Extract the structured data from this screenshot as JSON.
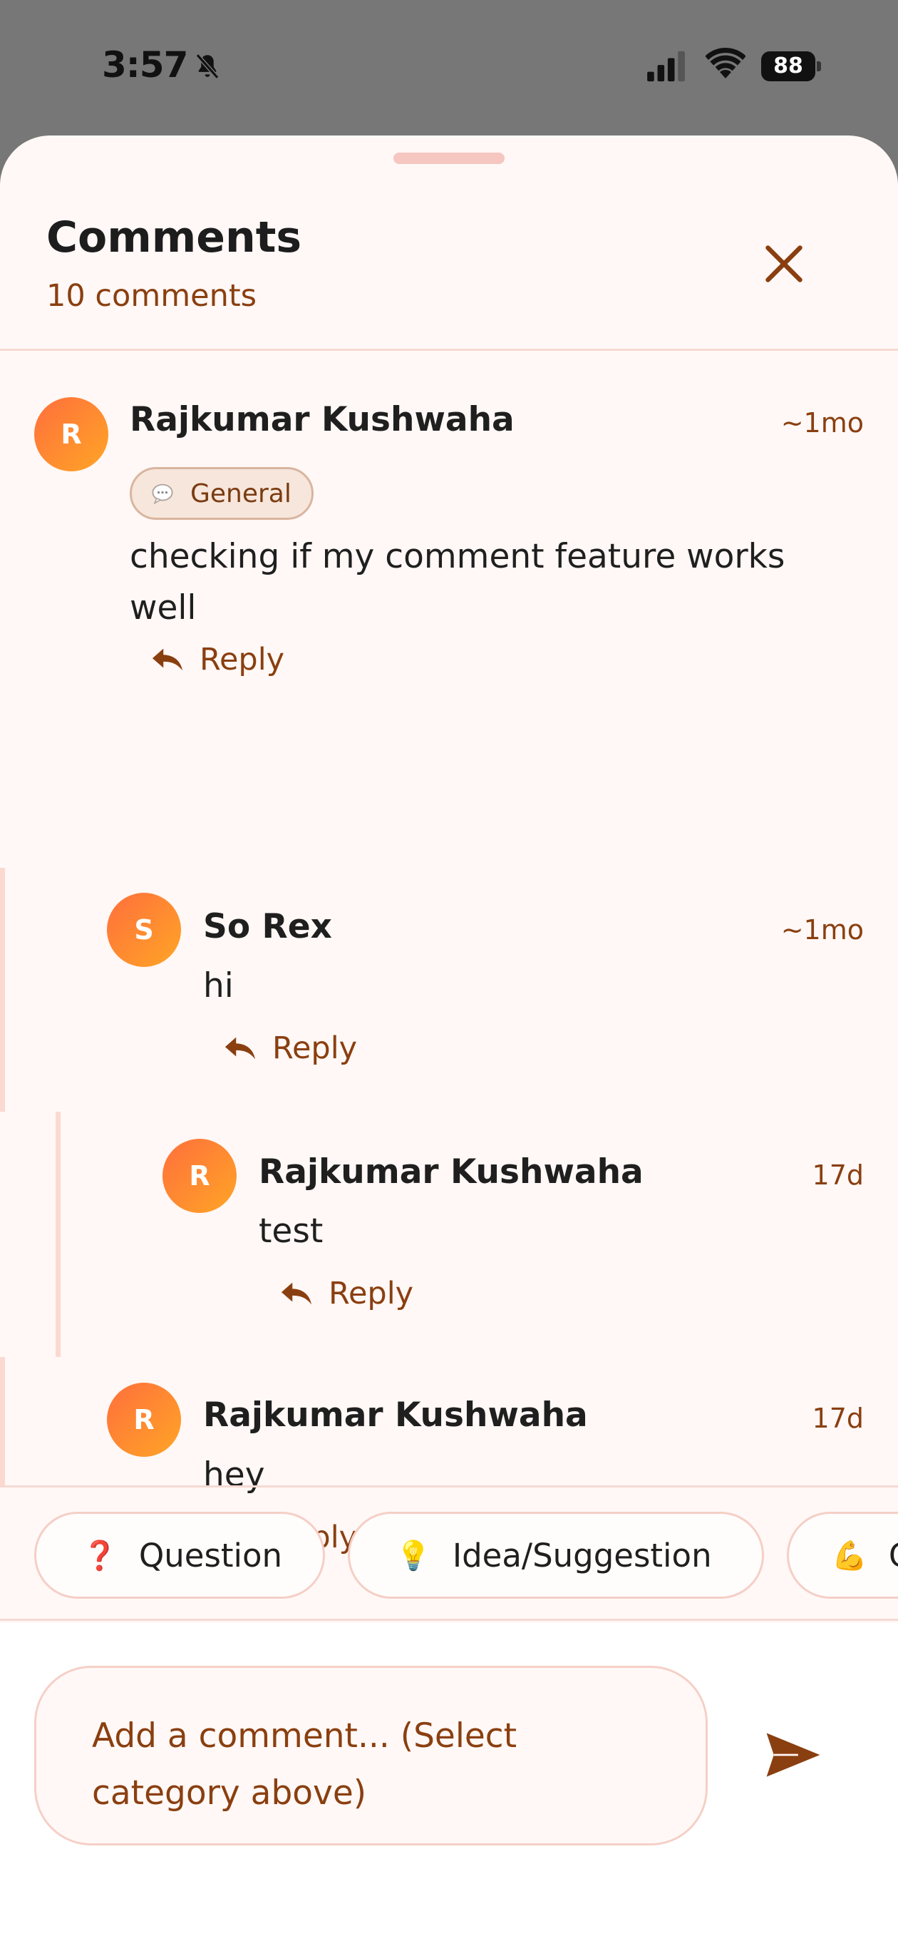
{
  "status_bar": {
    "time": "3:57",
    "battery": "88"
  },
  "sheet": {
    "title": "Comments",
    "count_label": "10 comments"
  },
  "comments": [
    {
      "avatar_initial": "R",
      "author": "Rajkumar Kushwaha",
      "time": "~1mo",
      "tag": "General",
      "text": "checking if my comment feature works well",
      "reply_label": "Reply"
    },
    {
      "avatar_initial": "S",
      "author": "So Rex",
      "time": "~1mo",
      "text": "hi",
      "reply_label": "Reply"
    },
    {
      "avatar_initial": "R",
      "author": "Rajkumar Kushwaha",
      "time": "17d",
      "text": "test",
      "reply_label": "Reply"
    },
    {
      "avatar_initial": "R",
      "author": "Rajkumar Kushwaha",
      "time": "17d",
      "text": "hey",
      "reply_label": "Reply"
    }
  ],
  "categories": [
    {
      "icon": "❓",
      "label": "Question"
    },
    {
      "icon": "💡",
      "label": "Idea/Suggestion"
    },
    {
      "icon": "💪",
      "label": "C"
    }
  ],
  "compose": {
    "placeholder": "Add a comment... (Select category above)"
  },
  "colors": {
    "accent": "#8a3f10",
    "avatar_start": "#ff6f3c",
    "avatar_end": "#ffa526",
    "sheet_bg": "#fff8f6",
    "thread_line": "#fbd9d1"
  },
  "icons": {
    "status": [
      "bell-slash-icon",
      "cellular-signal-icon",
      "wifi-icon",
      "battery-icon"
    ],
    "header": "close-icon",
    "reply": "reply-arrow-icon",
    "tag": "speech-bubble-icon",
    "send": "send-icon"
  }
}
